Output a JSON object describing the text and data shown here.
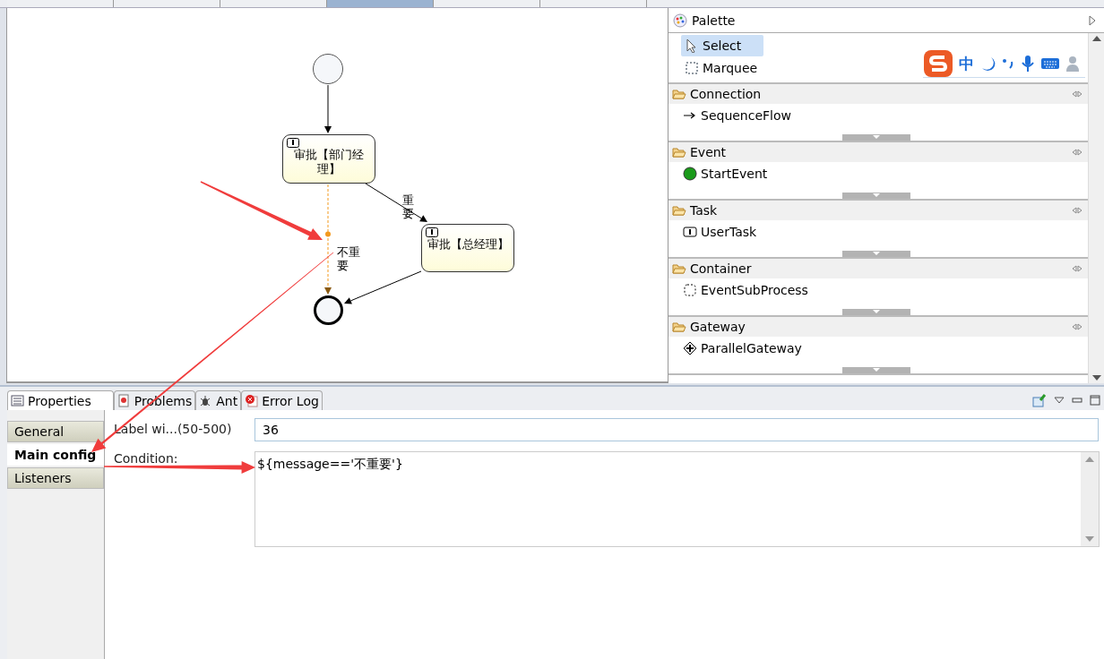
{
  "editor_tabs": [
    {
      "selected": false
    },
    {
      "selected": false
    },
    {
      "selected": false
    },
    {
      "selected": true
    },
    {
      "selected": false
    },
    {
      "selected": false
    }
  ],
  "diagram": {
    "nodes": [
      {
        "kind": "start_event"
      },
      {
        "kind": "user_task",
        "label": "审批【部门经理】"
      },
      {
        "kind": "user_task",
        "label": "审批【总经理】"
      },
      {
        "kind": "end_event"
      }
    ],
    "edges": [
      {
        "selected": false
      },
      {
        "label": "重要",
        "selected": false
      },
      {
        "label": "不重要",
        "selected": true
      },
      {
        "selected": false
      }
    ]
  },
  "palette": {
    "title": "Palette",
    "tools": [
      {
        "label": "Select",
        "kind": "select",
        "selected": true
      },
      {
        "label": "Marquee",
        "kind": "marquee",
        "selected": false
      }
    ],
    "drawers": [
      {
        "title": "Connection",
        "item": {
          "label": "SequenceFlow",
          "kind": "sequence_flow"
        }
      },
      {
        "title": "Event",
        "item": {
          "label": "StartEvent",
          "kind": "start_event"
        }
      },
      {
        "title": "Task",
        "item": {
          "label": "UserTask",
          "kind": "user_task"
        }
      },
      {
        "title": "Container",
        "item": {
          "label": "EventSubProcess",
          "kind": "event_subprocess"
        }
      },
      {
        "title": "Gateway",
        "item": {
          "label": "ParallelGateway",
          "kind": "parallel_gateway"
        }
      }
    ]
  },
  "ime_toolbar": {
    "mode": "中"
  },
  "properties": {
    "tabs": [
      {
        "label": "Properties",
        "kind": "properties",
        "selected": true
      },
      {
        "label": "Problems",
        "kind": "problems",
        "selected": false
      },
      {
        "label": "Ant",
        "kind": "ant",
        "selected": false
      },
      {
        "label": "Error Log",
        "kind": "error_log",
        "selected": false
      }
    ],
    "sections": [
      {
        "label": "General",
        "selected": false
      },
      {
        "label": "Main config",
        "selected": true
      },
      {
        "label": "Listeners",
        "selected": false
      }
    ],
    "fields": [
      {
        "label": "Label wi...(50-500)",
        "value": "36",
        "kind": "text"
      },
      {
        "label": "Condition:",
        "value": "${message=='不重要'}",
        "kind": "multiline"
      }
    ]
  }
}
